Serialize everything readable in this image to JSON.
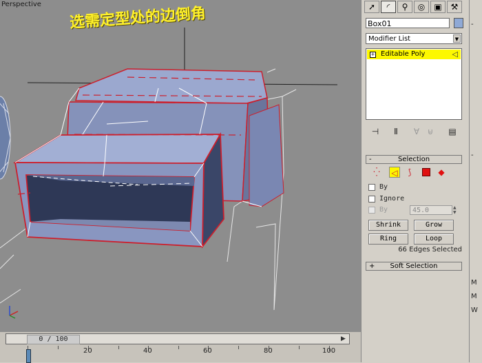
{
  "viewport": {
    "label": "Perspective",
    "overlay_title": "选需定型处的边倒角"
  },
  "timeline": {
    "frame_counter": "0 / 100",
    "ticks": [
      "20",
      "40",
      "60",
      "80",
      "100"
    ]
  },
  "command_panel": {
    "tabs": [
      "create-icon",
      "modify-icon",
      "hierarchy-icon",
      "motion-icon",
      "display-icon",
      "utilities-icon"
    ],
    "object_name": "Box01",
    "object_color": "#8fa9d6",
    "modifier_list_label": "Modifier List",
    "stack_item": "Editable Poly",
    "selection_rollout": {
      "title": "Selection",
      "by_vertex_label": "By",
      "ignore_backfacing_label": "Ignore",
      "by_angle_label": "By",
      "angle_value": "45.0",
      "shrink_label": "Shrink",
      "grow_label": "Grow",
      "ring_label": "Ring",
      "loop_label": "Loop",
      "status": "66 Edges Selected"
    },
    "soft_selection_title": "Soft Selection"
  }
}
